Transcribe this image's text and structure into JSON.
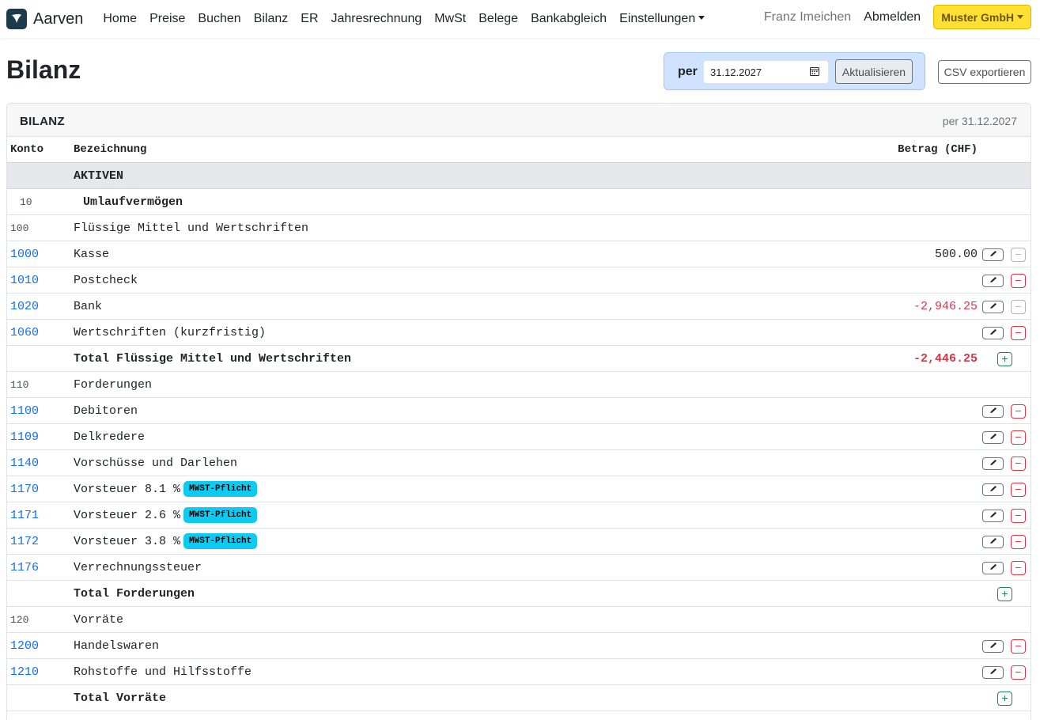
{
  "app": {
    "name": "Aarven",
    "logo_icon": "bird-logo-icon"
  },
  "nav": {
    "links": [
      "Home",
      "Preise",
      "Buchen",
      "Bilanz",
      "ER",
      "Jahresrechnung",
      "MwSt",
      "Belege",
      "Bankabgleich",
      "Einstellungen"
    ],
    "user": "Franz Imeichen",
    "logout": "Abmelden",
    "company": "Muster GmbH"
  },
  "header": {
    "title": "Bilanz",
    "per_label": "per",
    "date_value": "31.12.2027",
    "refresh_label": "Aktualisieren",
    "csv_label": "CSV exportieren"
  },
  "card": {
    "title": "BILANZ",
    "subtitle": "per 31.12.2027"
  },
  "table": {
    "columns": [
      "Konto",
      "Bezeichnung",
      "Betrag (CHF)"
    ],
    "rows": [
      {
        "type": "section",
        "konto": "",
        "label": "AKTIVEN",
        "amount": ""
      },
      {
        "type": "group",
        "konto": "10",
        "label": "Umlaufvermögen",
        "amount": ""
      },
      {
        "type": "subgroup",
        "konto": "100",
        "label": "Flüssige Mittel und Wertschriften",
        "amount": ""
      },
      {
        "type": "account",
        "konto": "1000",
        "label": "Kasse",
        "amount": "500.00",
        "negative": false,
        "delete_enabled": false
      },
      {
        "type": "account",
        "konto": "1010",
        "label": "Postcheck",
        "amount": "",
        "negative": false,
        "delete_enabled": true
      },
      {
        "type": "account",
        "konto": "1020",
        "label": "Bank",
        "amount": "-2,946.25",
        "negative": true,
        "delete_enabled": false
      },
      {
        "type": "account",
        "konto": "1060",
        "label": "Wertschriften (kurzfristig)",
        "amount": "",
        "negative": false,
        "delete_enabled": true
      },
      {
        "type": "total",
        "konto": "",
        "label": "Total Flüssige Mittel und Wertschriften",
        "amount": "-2,446.25",
        "negative": true
      },
      {
        "type": "subgroup",
        "konto": "110",
        "label": "Forderungen",
        "amount": ""
      },
      {
        "type": "account",
        "konto": "1100",
        "label": "Debitoren",
        "amount": "",
        "negative": false,
        "delete_enabled": true
      },
      {
        "type": "account",
        "konto": "1109",
        "label": "Delkredere",
        "amount": "",
        "negative": false,
        "delete_enabled": true
      },
      {
        "type": "account",
        "konto": "1140",
        "label": "Vorschüsse und Darlehen",
        "amount": "",
        "negative": false,
        "delete_enabled": true
      },
      {
        "type": "account",
        "konto": "1170",
        "label": "Vorsteuer 8.1 %",
        "badge": "MWST-Pflicht",
        "amount": "",
        "negative": false,
        "delete_enabled": true
      },
      {
        "type": "account",
        "konto": "1171",
        "label": "Vorsteuer 2.6 %",
        "badge": "MWST-Pflicht",
        "amount": "",
        "negative": false,
        "delete_enabled": true
      },
      {
        "type": "account",
        "konto": "1172",
        "label": "Vorsteuer 3.8 %",
        "badge": "MWST-Pflicht",
        "amount": "",
        "negative": false,
        "delete_enabled": true
      },
      {
        "type": "account",
        "konto": "1176",
        "label": "Verrechnungssteuer",
        "amount": "",
        "negative": false,
        "delete_enabled": true
      },
      {
        "type": "total",
        "konto": "",
        "label": "Total Forderungen",
        "amount": "",
        "negative": false
      },
      {
        "type": "subgroup",
        "konto": "120",
        "label": "Vorräte",
        "amount": ""
      },
      {
        "type": "account",
        "konto": "1200",
        "label": "Handelswaren",
        "amount": "",
        "negative": false,
        "delete_enabled": true
      },
      {
        "type": "account",
        "konto": "1210",
        "label": "Rohstoffe und Hilfsstoffe",
        "amount": "",
        "negative": false,
        "delete_enabled": true
      },
      {
        "type": "total",
        "konto": "",
        "label": "Total Vorräte",
        "amount": "",
        "negative": false
      }
    ]
  },
  "colors": {
    "link": "#0d6efd",
    "negative": "#dc3545",
    "badge": "#0dcaf0",
    "company": "#ffe033",
    "add": "#198754"
  }
}
